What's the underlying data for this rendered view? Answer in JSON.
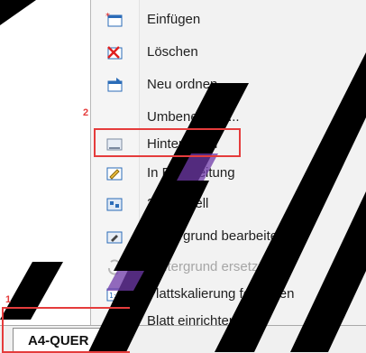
{
  "menu": {
    "items": [
      {
        "label": "Einfügen",
        "icon": "insert-layout-icon",
        "enabled": true
      },
      {
        "label": "Löschen",
        "icon": "delete-layout-icon",
        "enabled": true
      },
      {
        "label": "Neu ordnen...",
        "icon": "reorder-icon",
        "enabled": true
      },
      {
        "label": "Umbenennen...",
        "icon": "",
        "enabled": true
      },
      {
        "label": "Hintergrund",
        "icon": "background-icon",
        "enabled": true
      },
      {
        "label": "In Bearbeitung",
        "icon": "edit-mode-icon",
        "enabled": true
      },
      {
        "label": "2D-Modell",
        "icon": "model-2d-icon",
        "enabled": true
      },
      {
        "label": "Hintergrund bearbeiten",
        "icon": "edit-background-icon",
        "enabled": true
      },
      {
        "label": "Hintergrund ersetzen",
        "icon": "replace-background-icon",
        "enabled": false
      },
      {
        "label": "Plattskalierung festlegen",
        "icon": "scale-icon",
        "enabled": true
      },
      {
        "label": "Blatt einrichten...",
        "icon": "page-setup-icon",
        "enabled": true
      }
    ]
  },
  "annotations": {
    "marker_1": "1",
    "marker_2": "2"
  },
  "tabs": {
    "active_label": "A4-QUER"
  },
  "colors": {
    "highlight": "#e53c3c",
    "menu_bg": "#f2f2f2"
  }
}
